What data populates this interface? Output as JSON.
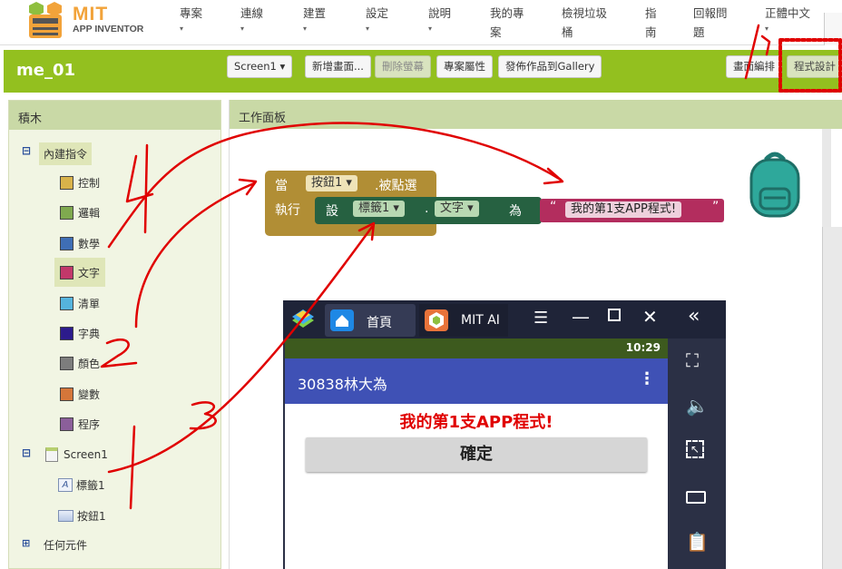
{
  "logo": {
    "title": "MIT",
    "subtitle": "APP INVENTOR"
  },
  "menu": [
    {
      "label": "專案",
      "label2": ""
    },
    {
      "label": "連線",
      "label2": ""
    },
    {
      "label": "建置",
      "label2": ""
    },
    {
      "label": "設定",
      "label2": ""
    },
    {
      "label": "說明",
      "label2": ""
    },
    {
      "label": "我的專",
      "label2": "案"
    },
    {
      "label": "檢視垃圾",
      "label2": "桶"
    },
    {
      "label": "指",
      "label2": "南"
    },
    {
      "label": "回報問",
      "label2": "題"
    },
    {
      "label": "正體中文",
      "label2": ""
    }
  ],
  "project": {
    "name": "me_01",
    "screen_select": "Screen1 ▾",
    "add_screen": "新增畫面...",
    "remove_screen": "刪除螢幕",
    "properties": "專案屬性",
    "publish": "發佈作品到Gallery",
    "designer": "畫面編排",
    "blocks": "程式設計"
  },
  "blocks_panel": {
    "title": "積木",
    "builtin": "內建指令",
    "categories": [
      {
        "label": "控制",
        "color": "#d9b34a"
      },
      {
        "label": "邏輯",
        "color": "#7fa94f"
      },
      {
        "label": "數學",
        "color": "#3f6eb5"
      },
      {
        "label": "文字",
        "color": "#c2386a"
      },
      {
        "label": "清單",
        "color": "#55b3dd"
      },
      {
        "label": "字典",
        "color": "#2c1b8c"
      },
      {
        "label": "顏色",
        "color": "#7d7d7d"
      },
      {
        "label": "變數",
        "color": "#d5763a"
      },
      {
        "label": "程序",
        "color": "#8b5f9a"
      }
    ],
    "screen": "Screen1",
    "components": [
      {
        "label": "標籤1"
      },
      {
        "label": "按鈕1"
      }
    ],
    "any_component": "任何元件"
  },
  "workspace": {
    "title": "工作面板",
    "event": {
      "when": "當",
      "component": "按鈕1 ▾",
      "event": ".被點選",
      "do": "執行"
    },
    "setter": {
      "set": "設",
      "component": "標籤1 ▾",
      "dot": ".",
      "property": "文字 ▾",
      "to": "為"
    },
    "text": {
      "open_quote": "“",
      "value": "我的第1支APP程式!",
      "close_quote": "”"
    }
  },
  "emulator": {
    "tab_home": "首頁",
    "tab_app": "MIT AI",
    "time": "10:29",
    "app_title": "30838林大為",
    "label_text": "我的第1支APP程式!",
    "button_text": "確定"
  },
  "colors": {
    "accent_green": "#93c01f",
    "event_block": "#b18e35",
    "setter_block": "#266141",
    "text_block": "#b32d5e",
    "annotation_red": "#e00000"
  }
}
